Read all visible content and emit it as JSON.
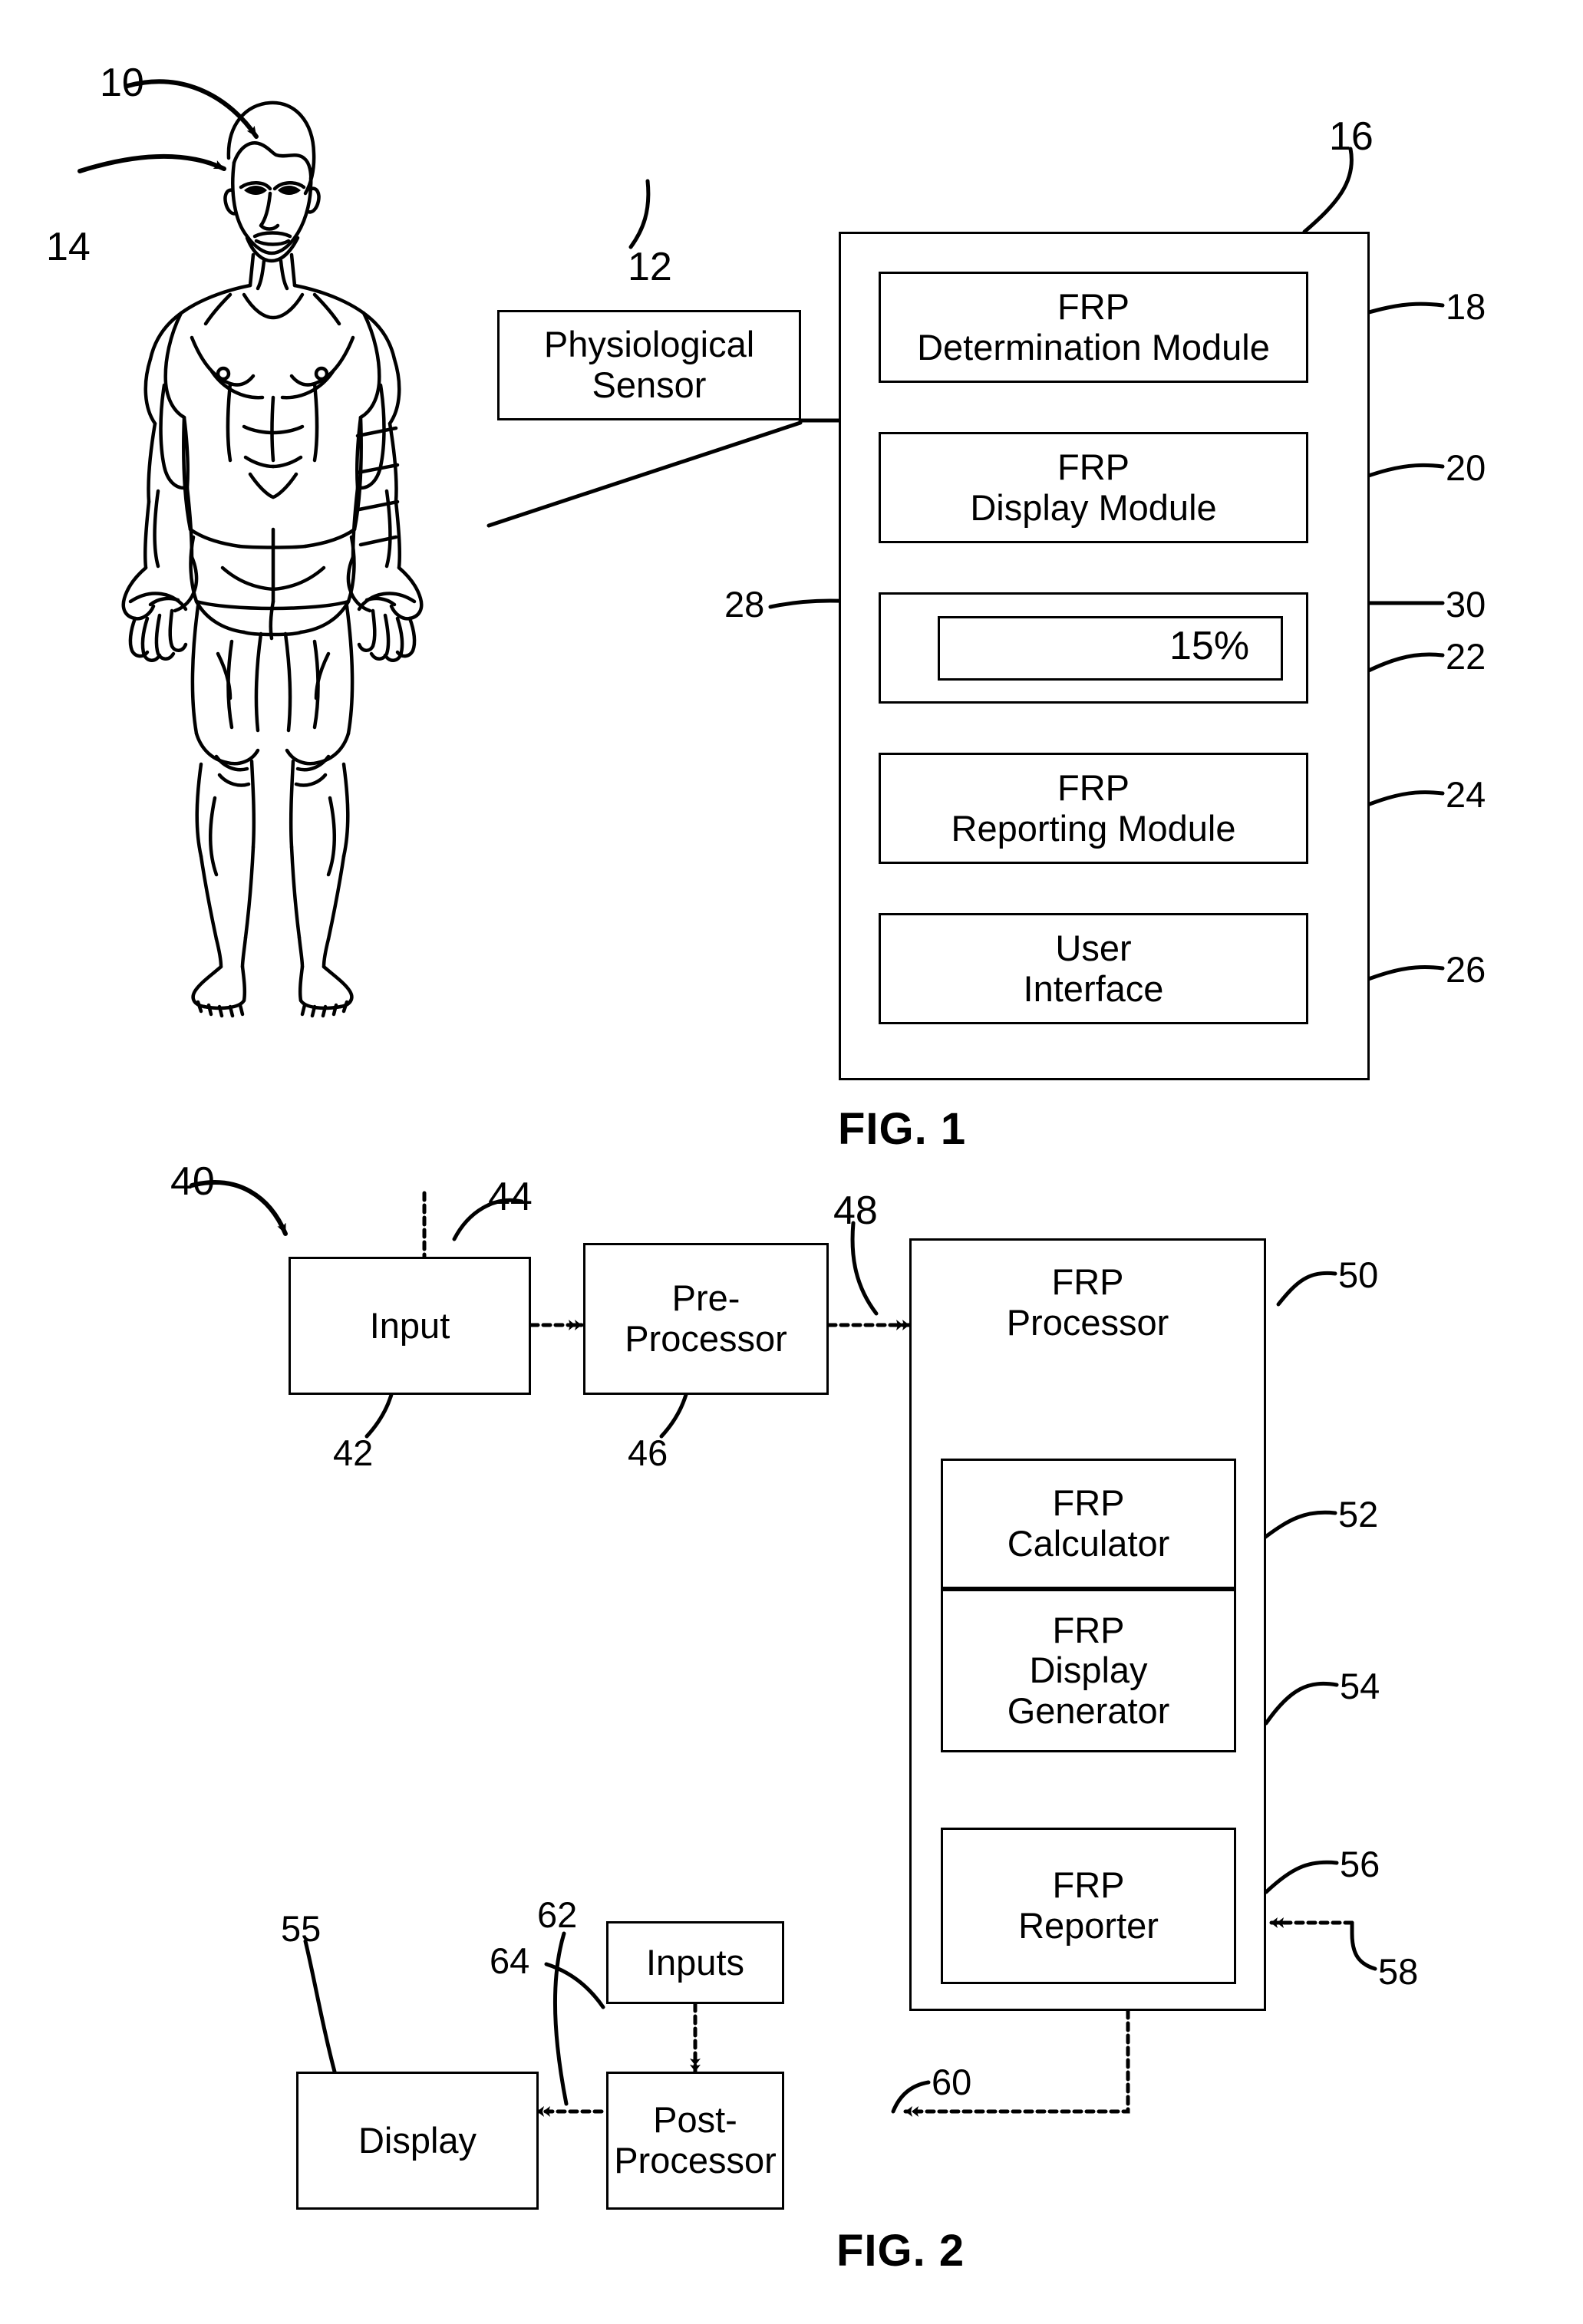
{
  "figures": [
    {
      "id": "fig1",
      "caption": "FIG. 1",
      "system_ref": "10",
      "patient_ref": "14",
      "sensor_ref": "12",
      "monitor_ref": "16",
      "sensor": {
        "label": "Physiological\nSensor"
      },
      "patient": {
        "label": "patient-body-figure"
      },
      "modules": [
        {
          "ref": "18",
          "label": "FRP\nDetermination Module",
          "name": "frp-determination-module"
        },
        {
          "ref": "20",
          "label": "FRP\nDisplay Module",
          "name": "frp-display-module"
        },
        {
          "ref": "22",
          "label": "",
          "name": "frp-display-area"
        },
        {
          "ref": "24",
          "label": "FRP\nReporting Module",
          "name": "frp-reporting-module"
        },
        {
          "ref": "26",
          "label": "User\nInterface",
          "name": "user-interface-module"
        }
      ],
      "display_readout": {
        "waveform_ref": "28",
        "waveform_icon": "pulse-waveform-icon",
        "value_ref": "30",
        "value": "15%"
      }
    },
    {
      "id": "fig2",
      "caption": "FIG. 2",
      "system_ref": "40",
      "blocks": [
        {
          "ref": "42",
          "label": "Input",
          "name": "input-block"
        },
        {
          "ref": "46",
          "label": "Pre-\nProcessor",
          "name": "pre-processor-block"
        },
        {
          "ref": "50",
          "label": "FRP\nProcessor",
          "name": "frp-processor-block"
        },
        {
          "ref": "52",
          "label": "FRP\nCalculator",
          "name": "frp-calculator-block"
        },
        {
          "ref": "54",
          "label": "FRP\nDisplay\nGenerator",
          "name": "frp-display-generator-block"
        },
        {
          "ref": "56",
          "label": "FRP\nReporter",
          "name": "frp-reporter-block"
        },
        {
          "ref": "64",
          "label": "Inputs",
          "name": "inputs-block"
        },
        {
          "ref": "60",
          "label": "Post-\nProcessor",
          "name": "post-processor-block"
        },
        {
          "ref": "55",
          "label": "Display",
          "name": "display-block"
        }
      ],
      "signals": [
        {
          "ref": "44",
          "name": "input-signal-arrow"
        },
        {
          "ref": "48",
          "name": "preprocessed-signal-arrow"
        },
        {
          "ref": "58",
          "name": "reporter-input-arrow"
        },
        {
          "ref": "62",
          "name": "display-feed-arrow"
        }
      ]
    }
  ],
  "colors": {
    "ink": "#000000",
    "paper": "#ffffff"
  }
}
